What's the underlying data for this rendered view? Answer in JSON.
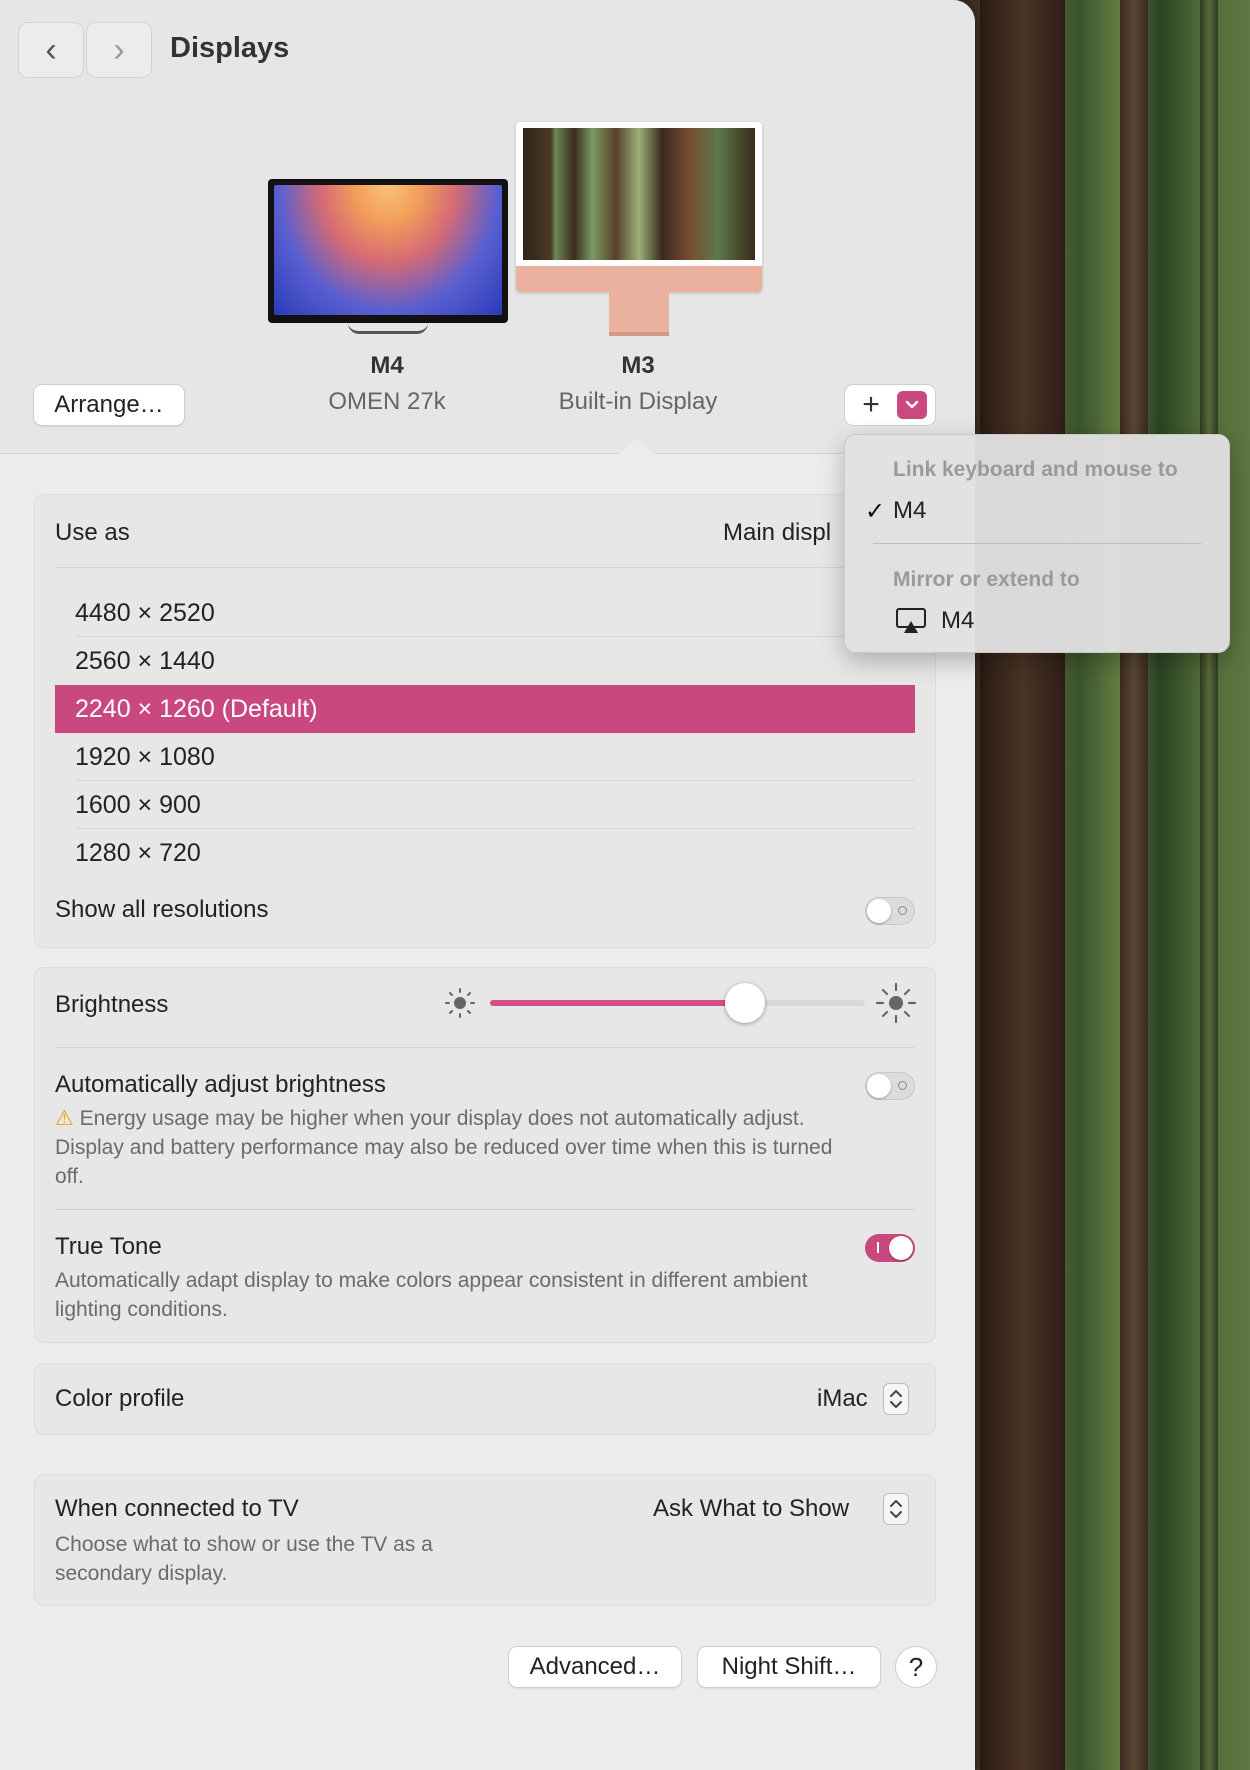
{
  "window": {
    "title": "Displays"
  },
  "nav": {
    "back_icon": "‹",
    "forward_icon": "›"
  },
  "displays": [
    {
      "name": "M4",
      "subtitle": "OMEN 27k"
    },
    {
      "name": "M3",
      "subtitle": "Built-in Display"
    }
  ],
  "toolbar": {
    "arrange_label": "Arrange…",
    "add_icon": "+",
    "dropdown_icon": "⌄"
  },
  "menu": {
    "link_heading": "Link keyboard and mouse to",
    "link_item": "M4",
    "checkmark": "✓",
    "mirror_heading": "Mirror or extend to",
    "mirror_item": "M4"
  },
  "use_as": {
    "label": "Use as",
    "value": "Main displ"
  },
  "resolutions": {
    "items": [
      "4480 × 2520",
      "2560 × 1440",
      "2240 × 1260 (Default)",
      "1920 × 1080",
      "1600 × 900",
      "1280 × 720"
    ],
    "selected_index": 2,
    "show_all_label": "Show all resolutions",
    "show_all_on": false
  },
  "brightness": {
    "label": "Brightness",
    "level": 0.68,
    "auto_label": "Automatically adjust brightness",
    "auto_on": false,
    "auto_warning": "Energy usage may be higher when your display does not automatically adjust. Display and battery performance may also be reduced over time when this is turned off.",
    "warning_icon": "⚠"
  },
  "true_tone": {
    "label": "True Tone",
    "on": true,
    "description": "Automatically adapt display to make colors appear consistent in different ambient lighting conditions."
  },
  "color_profile": {
    "label": "Color profile",
    "value": "iMac"
  },
  "tv": {
    "label": "When connected to TV",
    "description": "Choose what to show or use the TV as a secondary display.",
    "value": "Ask What to Show"
  },
  "footer": {
    "advanced_label": "Advanced…",
    "night_shift_label": "Night Shift…",
    "help_label": "?"
  },
  "colors": {
    "accent": "#c8487f"
  }
}
